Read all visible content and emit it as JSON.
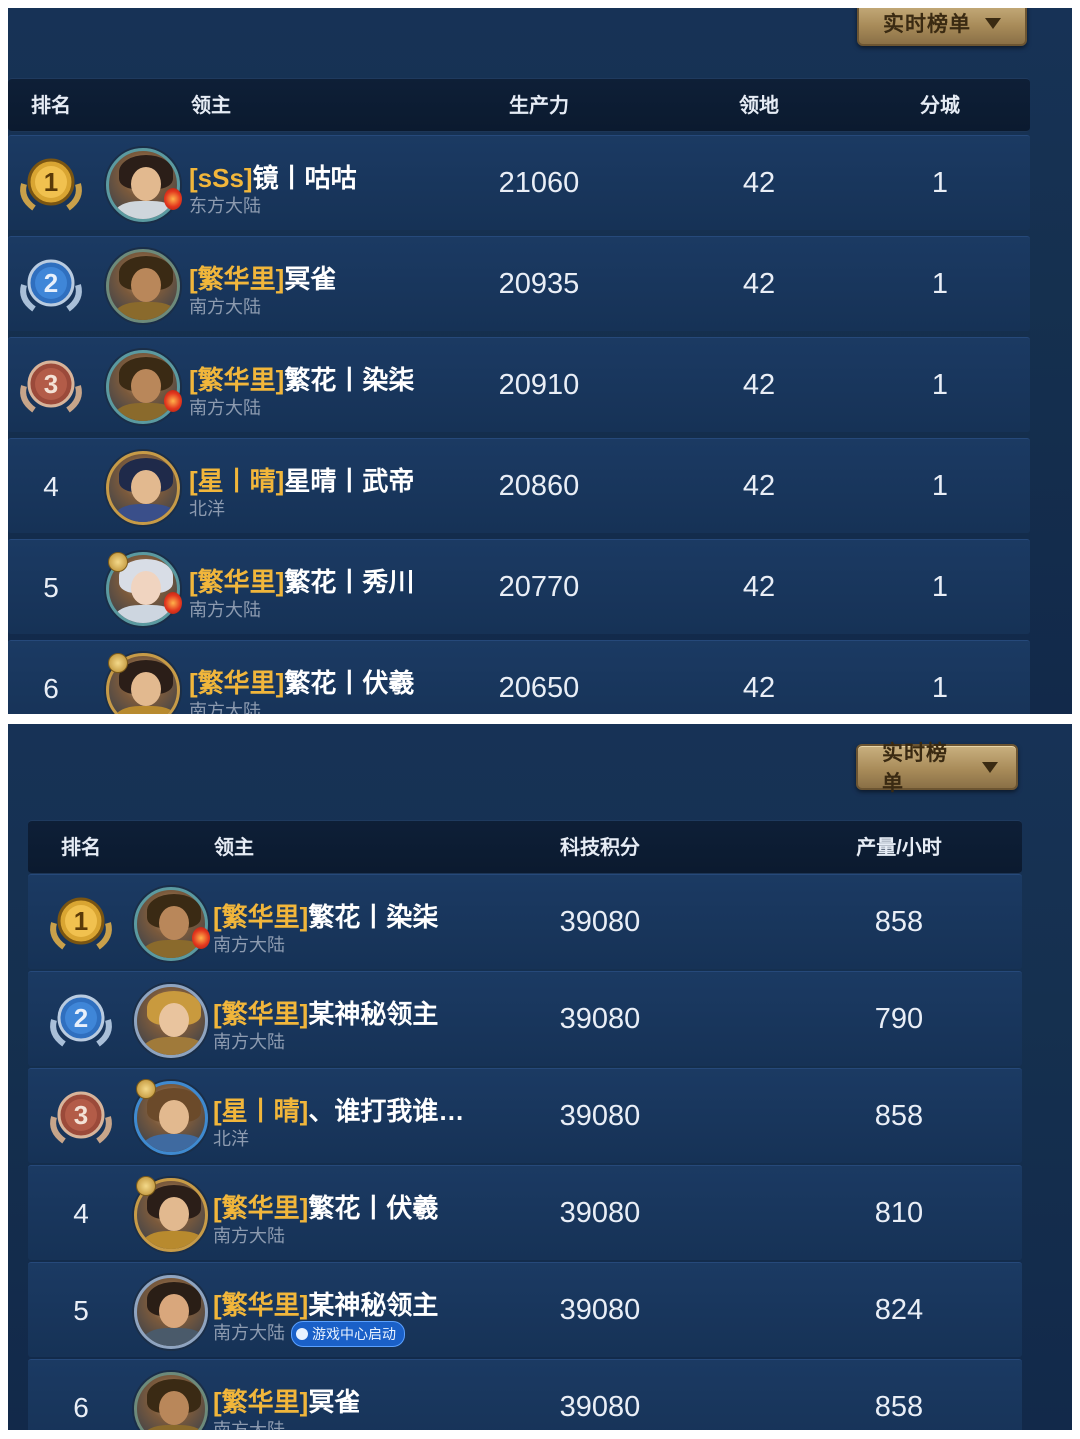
{
  "panel1": {
    "dropdown_label": "实时榜单",
    "headers": {
      "rank": "排名",
      "lord": "领主",
      "production": "生产力",
      "territory": "领地",
      "branch_city": "分城"
    },
    "rows": [
      {
        "rank": "1",
        "guild": "[sSs]",
        "name": "镜丨咕咕",
        "region": "东方大陆",
        "production": "21060",
        "territory": "42",
        "branch_city": "1"
      },
      {
        "rank": "2",
        "guild": "[繁华里]",
        "name": "冥雀",
        "region": "南方大陆",
        "production": "20935",
        "territory": "42",
        "branch_city": "1"
      },
      {
        "rank": "3",
        "guild": "[繁华里]",
        "name": "繁花丨染柒",
        "region": "南方大陆",
        "production": "20910",
        "territory": "42",
        "branch_city": "1"
      },
      {
        "rank": "4",
        "guild": "[星丨晴]",
        "name": "星晴丨武帝",
        "region": "北洋",
        "production": "20860",
        "territory": "42",
        "branch_city": "1"
      },
      {
        "rank": "5",
        "guild": "[繁华里]",
        "name": "繁花丨秀川",
        "region": "南方大陆",
        "production": "20770",
        "territory": "42",
        "branch_city": "1"
      },
      {
        "rank": "6",
        "guild": "[繁华里]",
        "name": "繁花丨伏羲",
        "region": "南方大陆",
        "production": "20650",
        "territory": "42",
        "branch_city": "1"
      }
    ]
  },
  "panel2": {
    "dropdown_label": "实时榜单",
    "headers": {
      "rank": "排名",
      "lord": "领主",
      "tech_score": "科技积分",
      "output_per_hour": "产量/小时"
    },
    "rows": [
      {
        "rank": "1",
        "guild": "[繁华里]",
        "name": "繁花丨染柒",
        "region": "南方大陆",
        "tech_score": "39080",
        "output_per_hour": "858"
      },
      {
        "rank": "2",
        "guild": "[繁华里]",
        "name": "某神秘领主",
        "region": "南方大陆",
        "tech_score": "39080",
        "output_per_hour": "790"
      },
      {
        "rank": "3",
        "guild": "[星丨晴]",
        "name": "、谁打我谁…",
        "region": "北洋",
        "tech_score": "39080",
        "output_per_hour": "858"
      },
      {
        "rank": "4",
        "guild": "[繁华里]",
        "name": "繁花丨伏羲",
        "region": "南方大陆",
        "tech_score": "39080",
        "output_per_hour": "810"
      },
      {
        "rank": "5",
        "guild": "[繁华里]",
        "name": "某神秘领主",
        "region": "南方大陆",
        "tag": "游戏中心启动",
        "tech_score": "39080",
        "output_per_hour": "824"
      },
      {
        "rank": "6",
        "guild": "[繁华里]",
        "name": "冥雀",
        "region": "南方大陆",
        "tech_score": "39080",
        "output_per_hour": "858"
      }
    ]
  },
  "colors": {
    "guild_tag": "#f1b63b",
    "medal_gold": "#d9a532",
    "medal_silver": "#2f6fbf",
    "medal_bronze": "#9b4a3a"
  },
  "icons": {
    "medal_1": "gold-medal-icon",
    "medal_2": "silver-medal-icon",
    "medal_3": "bronze-medal-icon",
    "dropdown": "caret-down-icon"
  }
}
